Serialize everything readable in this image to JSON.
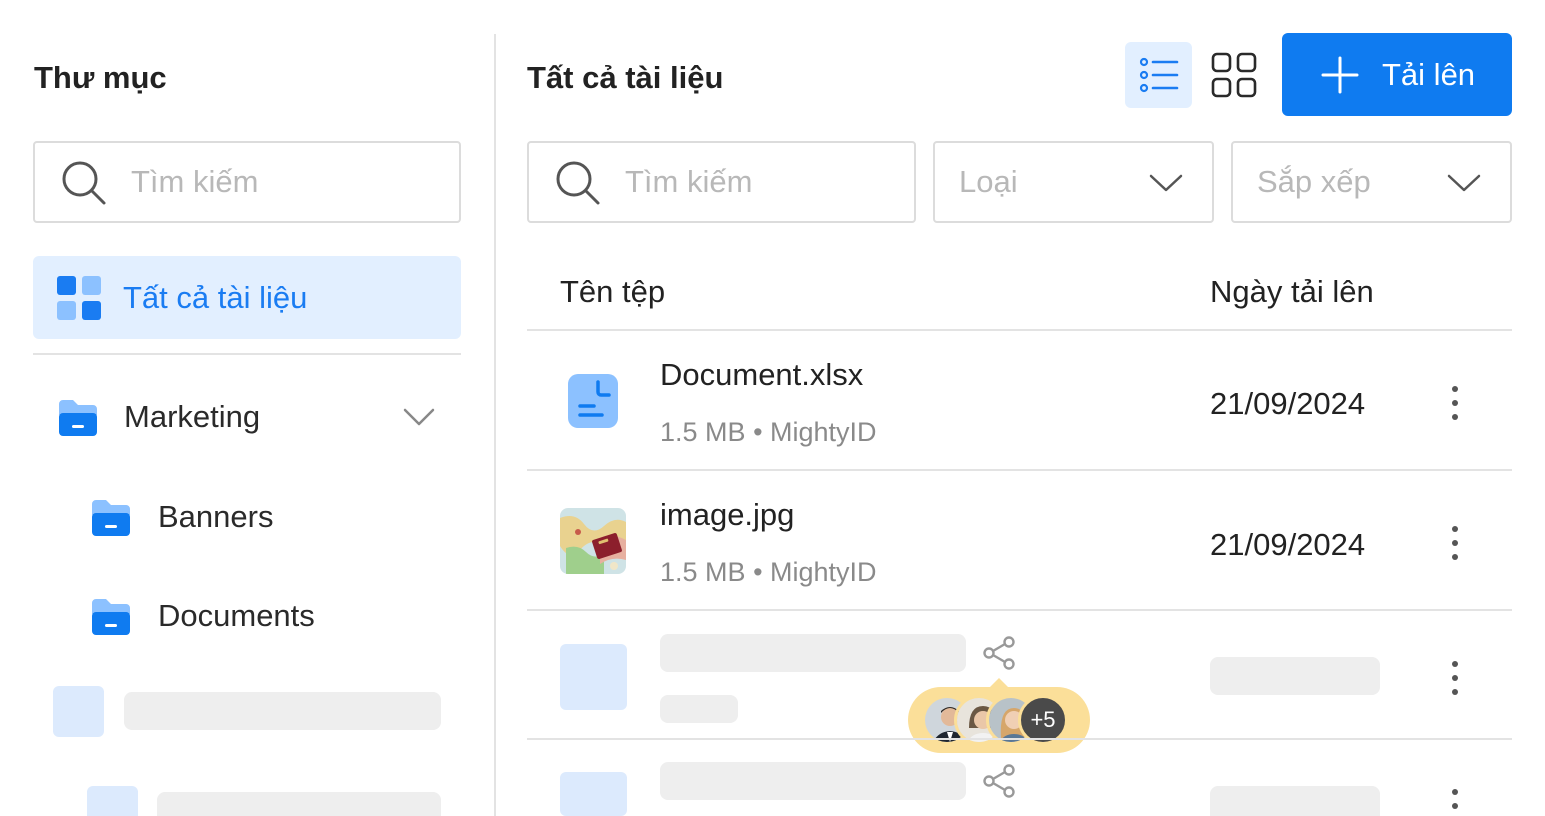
{
  "sidebar": {
    "title": "Thư mục",
    "search_placeholder": "Tìm kiếm",
    "all_docs_label": "Tất cả tài liệu",
    "folders": [
      {
        "label": "Marketing",
        "icon": "folder-icon",
        "expanded": true
      },
      {
        "label": "Banners",
        "icon": "folder-icon"
      },
      {
        "label": "Documents",
        "icon": "folder-icon"
      }
    ]
  },
  "main": {
    "title": "Tất cả tài liệu",
    "upload_label": "Tải lên",
    "search_placeholder": "Tìm kiếm",
    "filter_type_label": "Loại",
    "sort_label": "Sắp xếp",
    "columns": {
      "name": "Tên tệp",
      "date": "Ngày tải lên"
    },
    "files": [
      {
        "name": "Document.xlsx",
        "size": "1.5 MB",
        "separator": "•",
        "owner": "MightyID",
        "date": "21/09/2024",
        "icon": "document-icon"
      },
      {
        "name": "image.jpg",
        "size": "1.5 MB",
        "separator": "•",
        "owner": "MightyID",
        "date": "21/09/2024",
        "icon": "image-thumbnail"
      }
    ],
    "shared_more_count": "+5"
  },
  "colors": {
    "accent": "#0f7bf0",
    "accent_light": "#e2efff",
    "folder_light": "#8cc1ff",
    "folder_dark": "#0f7bf0",
    "skeleton": "#eeeeee",
    "skeleton_blue": "#dceafd",
    "share_pill": "#fbdf99"
  }
}
